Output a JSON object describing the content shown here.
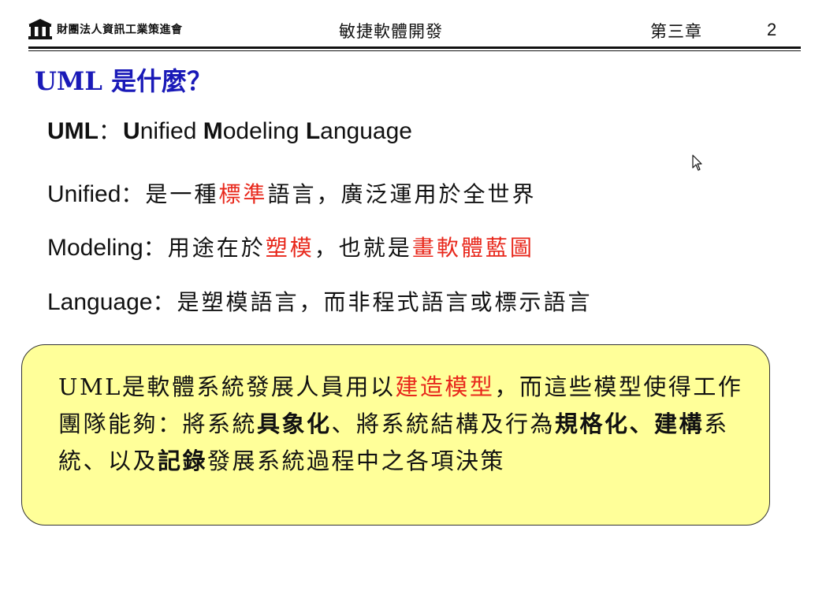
{
  "header": {
    "org_name": "財團法人資訊工業策進會",
    "course_title": "敏捷軟體開發",
    "chapter": "第三章",
    "page_number": "2"
  },
  "slide": {
    "title": "UML 是什麼？",
    "definition": {
      "u": "U",
      "ml": "ML",
      "colon": "：",
      "u2": "U",
      "nified": "nified ",
      "m": "M",
      "odeling": "odeling ",
      "l": "L",
      "anguage": "anguage"
    },
    "lines": [
      {
        "term": "Unified",
        "colon": "：",
        "parts": [
          "是一種",
          "標準",
          "語言，廣泛運用於全世界"
        ]
      },
      {
        "term": "Modeling",
        "colon": "：",
        "parts": [
          "用途在於",
          "塑模",
          "，也就是",
          "畫軟體藍圖"
        ]
      },
      {
        "term": "Language",
        "colon": "：",
        "parts": [
          "是塑模語言，而非程式語言或標示語言"
        ]
      }
    ],
    "callout": {
      "parts": [
        "UML是軟體系統發展人員用以",
        "建造模型",
        "，而這些模型使得工作團隊能夠：將系統",
        "具象化",
        "、將系統結構及行為",
        "規格化、建構",
        "系統、以及",
        "記錄",
        "發展系統過程中之各項決策"
      ]
    }
  },
  "colors": {
    "title_blue": "#1a1ab8",
    "highlight_red": "#e8281c",
    "callout_fill": "#ffff99"
  },
  "icons": {
    "logo": "building-columns-logo",
    "cursor": "mouse-pointer-icon"
  }
}
